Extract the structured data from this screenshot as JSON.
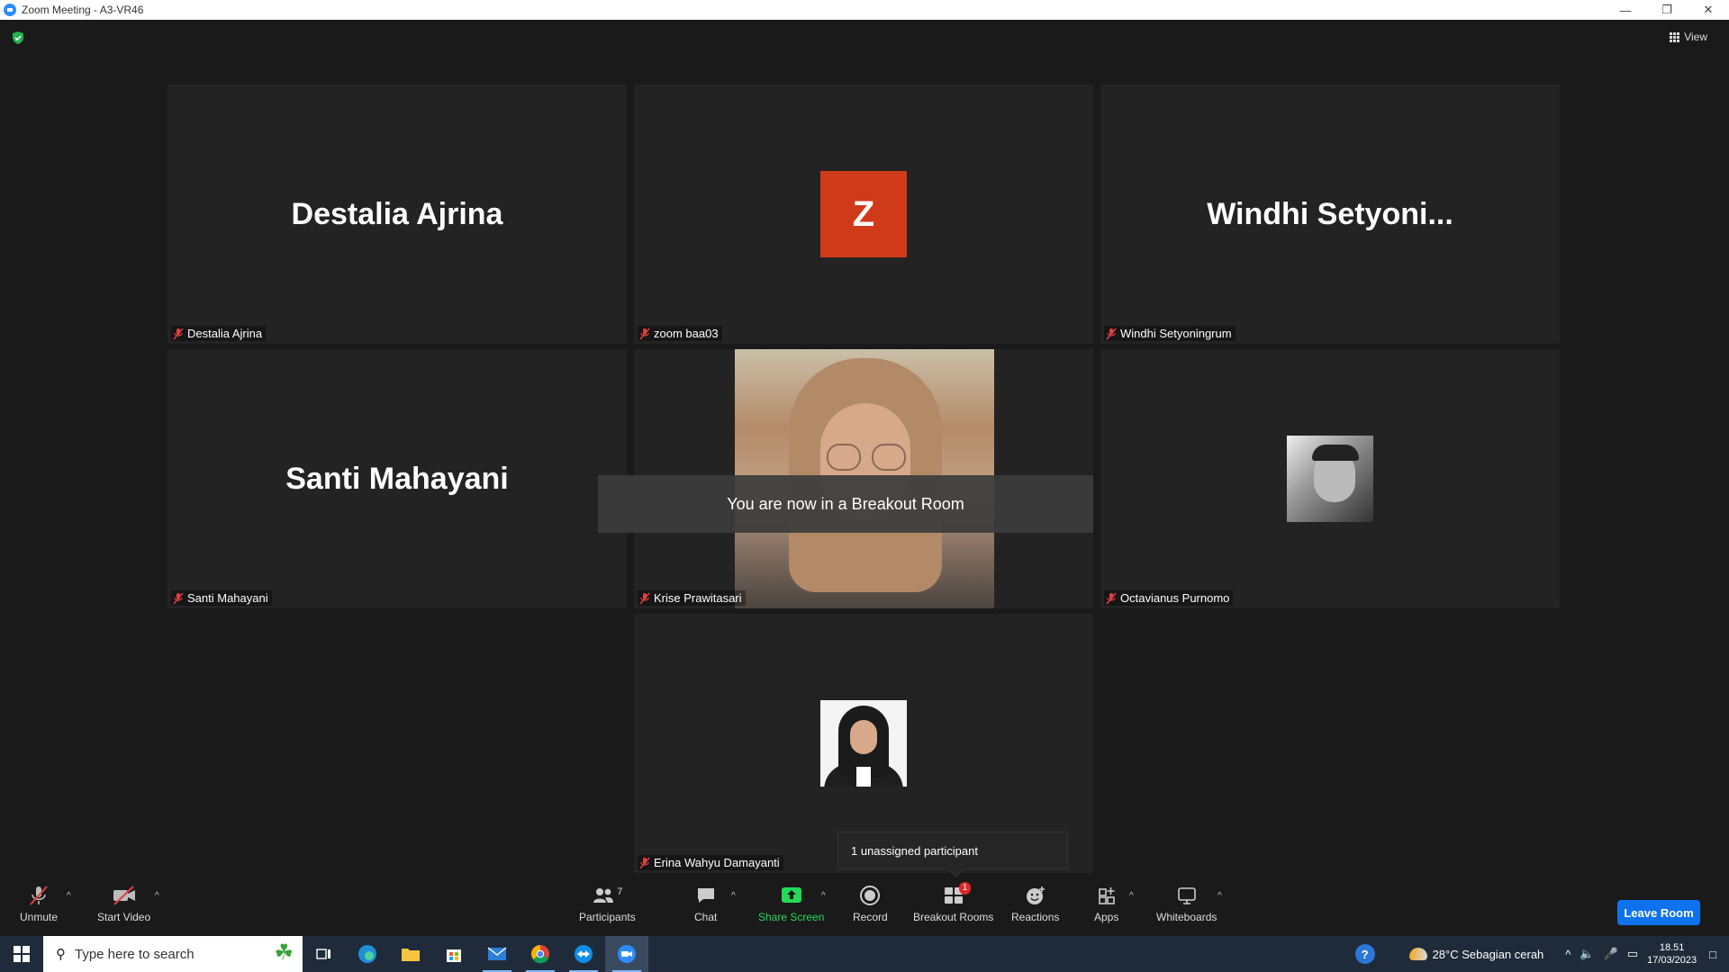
{
  "window": {
    "title": "Zoom Meeting - A3-VR46",
    "controls": [
      "minimize",
      "restore",
      "close"
    ]
  },
  "top": {
    "view_label": "View"
  },
  "tiles": [
    {
      "big_name": "Destalia Ajrina",
      "label": "Destalia Ajrina",
      "kind": "name"
    },
    {
      "avatar_letter": "Z",
      "label": "zoom baa03",
      "kind": "letter"
    },
    {
      "big_name": "Windhi  Setyoni...",
      "label": "Windhi Setyoningrum",
      "kind": "name"
    },
    {
      "big_name": "Santi Mahayani",
      "label": "Santi Mahayani",
      "kind": "name"
    },
    {
      "label": "Krise Prawitasari",
      "kind": "video"
    },
    {
      "label": "Octavianus Purnomo",
      "kind": "photo"
    },
    {
      "label": "Erina Wahyu Damayanti",
      "kind": "photo"
    }
  ],
  "toast": "You are now in a Breakout Room",
  "tooltip": "1 unassigned participant",
  "toolbar": {
    "unmute": "Unmute",
    "start_video": "Start Video",
    "participants": "Participants",
    "participants_count": "7",
    "chat": "Chat",
    "share_screen": "Share Screen",
    "record": "Record",
    "breakout_rooms": "Breakout Rooms",
    "breakout_badge": "1",
    "reactions": "Reactions",
    "apps": "Apps",
    "whiteboards": "Whiteboards",
    "leave": "Leave Room"
  },
  "taskbar": {
    "search_placeholder": "Type here to search",
    "weather": "28°C  Sebagian cerah",
    "time": "18.51",
    "date": "17/03/2023"
  },
  "colors": {
    "accent": "#0e72ed",
    "share_green": "#23d959",
    "avatar_orange": "#cf3a18",
    "badge_red": "#e02828"
  }
}
